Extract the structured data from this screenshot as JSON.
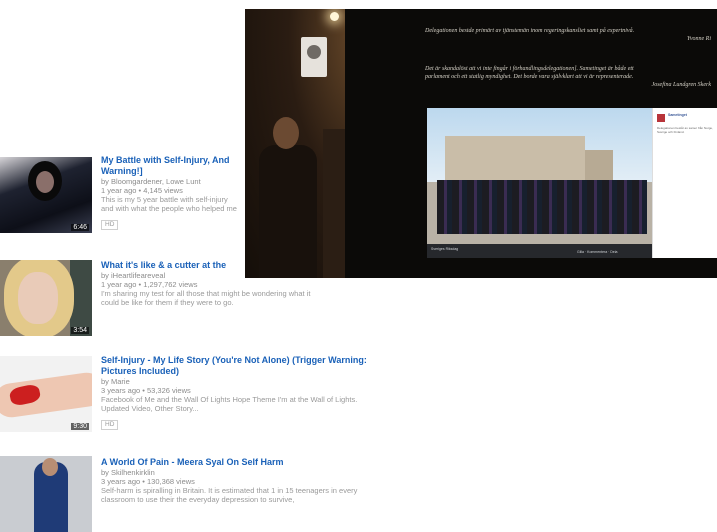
{
  "results": [
    {
      "title": "My Battle with Self-Injury, And",
      "title2": "Warning!]",
      "by": "by Bloomgardener, Lowe Lunt",
      "age": "1 year ago • 4,145 views",
      "desc": "This is my 5 year battle with self-injury",
      "desc2": "and with what the people who helped me",
      "badge": "HD",
      "duration": "6:46"
    },
    {
      "title": "What it's like & a cutter at the",
      "by": "by iHeartlifeareveal",
      "age": "1 year ago • 1,297,762 views",
      "desc": "I'm sharing my test for all those that might be wondering what it",
      "desc2": "could be like for them if they were to go.",
      "duration": "3:54"
    },
    {
      "title": "Self-Injury - My Life Story (You're Not Alone) (Trigger Warning:",
      "title2": "Pictures Included)",
      "by": "by Marie",
      "age": "3 years ago • 53,326 views",
      "desc": "Facebook of Me and the Wall Of Lights Hope Theme I'm at the Wall of Lights.",
      "desc2": "Updated Video, Other Story...",
      "badge": "HD",
      "duration": "9:30"
    },
    {
      "title": "A World Of Pain - Meera Syal On Self Harm",
      "by": "by Skilhenkirklin",
      "age": "3 years ago • 130,368 views",
      "desc": "Self-harm is spiralling in Britain. It is estimated that 1 in 15 teenagers in every",
      "desc2": "classroom to use their the everyday depression to survive,"
    }
  ],
  "photo": {
    "quote1": "Delegationen bestde primärt av tjänstemän inom regeringskansliet samt på expertnivå.",
    "quote1_attr": "Yvonne Ri",
    "quote2": "Det är skandalöst att vi inte fingår i förhandlingsdelegationen]. Sametinget är både ett",
    "quote2b": "parlament och ett statlig myndighet. Det borde vara självklart att vi är representerade.",
    "quote2_attr": "Josefina Lundgren Skerk",
    "caption_name": "Sveriges Riksdag",
    "caption_actions": "Gilla · Kommentera · Dela",
    "sidebar_user": "Sametinget",
    "sidebar_text": "Delegationen består av samer från Norge, Sverige och Finland."
  }
}
